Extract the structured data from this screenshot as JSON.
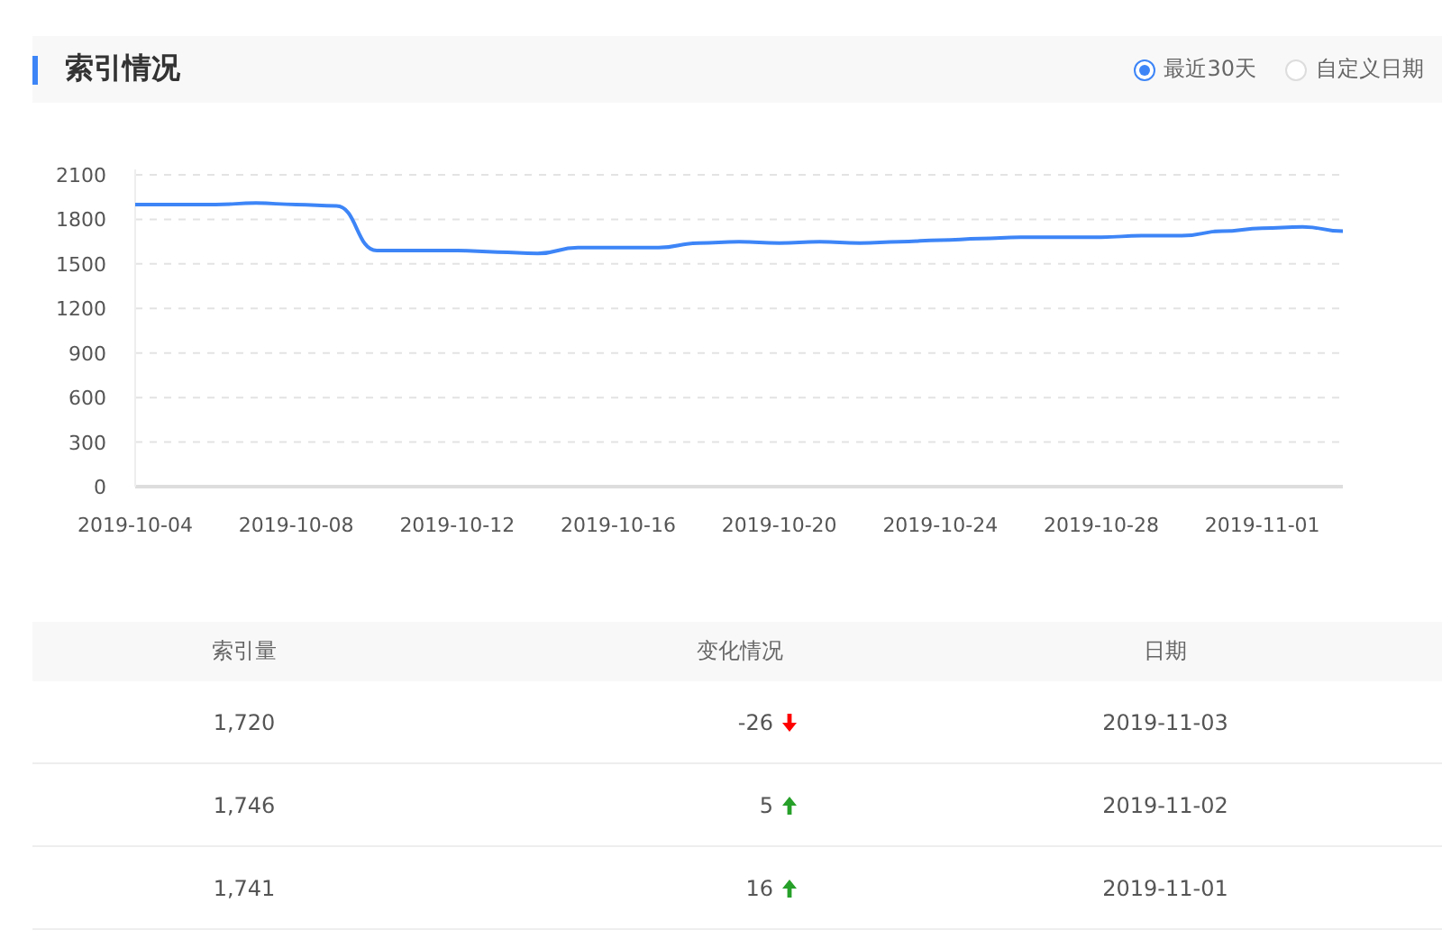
{
  "header": {
    "title": "索引情况",
    "range_options": [
      {
        "label": "最近30天",
        "selected": true
      },
      {
        "label": "自定义日期",
        "selected": false
      }
    ]
  },
  "chart_data": {
    "type": "line",
    "x": [
      "2019-10-04",
      "2019-10-05",
      "2019-10-06",
      "2019-10-07",
      "2019-10-08",
      "2019-10-09",
      "2019-10-10",
      "2019-10-11",
      "2019-10-12",
      "2019-10-13",
      "2019-10-14",
      "2019-10-15",
      "2019-10-16",
      "2019-10-17",
      "2019-10-18",
      "2019-10-19",
      "2019-10-20",
      "2019-10-21",
      "2019-10-22",
      "2019-10-23",
      "2019-10-24",
      "2019-10-25",
      "2019-10-26",
      "2019-10-27",
      "2019-10-28",
      "2019-10-29",
      "2019-10-30",
      "2019-10-31",
      "2019-11-01",
      "2019-11-02",
      "2019-11-03"
    ],
    "series": [
      {
        "color": "#3d85f7",
        "values": [
          1900,
          1900,
          1900,
          1910,
          1900,
          1890,
          1590,
          1590,
          1590,
          1580,
          1570,
          1610,
          1610,
          1610,
          1640,
          1650,
          1640,
          1650,
          1640,
          1650,
          1660,
          1670,
          1680,
          1680,
          1680,
          1690,
          1690,
          1720,
          1740,
          1750,
          1720
        ]
      }
    ],
    "xlim": [
      "2019-10-04",
      "2019-11-03"
    ],
    "grid": true,
    "ylim": [
      0,
      2100
    ],
    "yticks": [
      0,
      300,
      600,
      900,
      1200,
      1500,
      1800,
      2100
    ],
    "xticks": [
      "2019-10-04",
      "2019-10-08",
      "2019-10-12",
      "2019-10-16",
      "2019-10-20",
      "2019-10-24",
      "2019-10-28",
      "2019-11-01"
    ]
  },
  "table": {
    "columns": [
      "索引量",
      "变化情况",
      "日期"
    ],
    "rows": [
      {
        "count": "1,720",
        "change": "-26",
        "kind": "down",
        "date": "2019-11-03"
      },
      {
        "count": "1,746",
        "change": "5",
        "kind": "up",
        "date": "2019-11-02"
      },
      {
        "count": "1,741",
        "change": "16",
        "kind": "up",
        "date": "2019-11-01"
      }
    ]
  }
}
